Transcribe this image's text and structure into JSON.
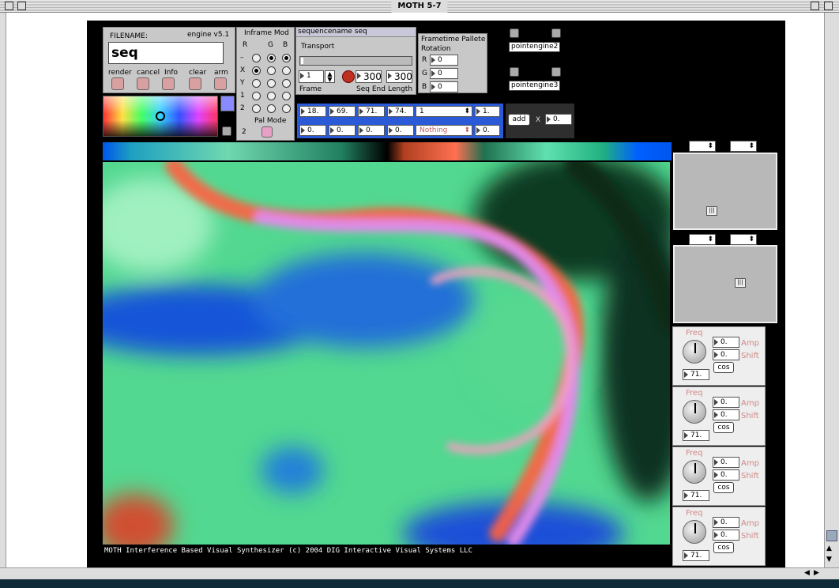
{
  "window": {
    "title": "MOTH 5-7"
  },
  "file_panel": {
    "filename_label": "FILENAME:",
    "version": "engine v5.1",
    "filename_value": "seq",
    "buttons": [
      "render",
      "cancel",
      "Info",
      "clear",
      "arm"
    ]
  },
  "inframe": {
    "title": "Inframe Mod",
    "cols": [
      "R",
      "G",
      "B"
    ],
    "rows": [
      "–",
      "X",
      "Y",
      "1",
      "2"
    ],
    "pal_label": "Pal Mode",
    "pal_value": "2"
  },
  "sequence": {
    "header": "sequencename seq",
    "transport": "Transport",
    "frame_value": "1",
    "frame_label": "Frame",
    "seq_end_value": "300",
    "seq_end_label": "Seq End",
    "length_value": "300",
    "length_label": "Length"
  },
  "palette": {
    "title": "Frametime Pallete",
    "subtitle": "Rotation",
    "r_label": "R",
    "r_value": "0",
    "g_label": "G",
    "g_value": "0",
    "b_label": "B",
    "b_value": "0"
  },
  "engines": {
    "engine2": "pointengine2",
    "engine3": "pointengine3"
  },
  "row1": {
    "v1": "18.",
    "v2": "69.",
    "v3": "71.",
    "v4": "74.",
    "menu": "1",
    "end": "1."
  },
  "row2": {
    "v1": "0.",
    "v2": "0.",
    "v3": "0.",
    "v4": "0.",
    "menu": "Nothing",
    "end": "0."
  },
  "add": {
    "label": "add",
    "x": "X",
    "value": "0."
  },
  "footer": "MOTH Interference Based Visual Synthesizer (c) 2004 DIG Interactive Visual Systems LLC",
  "lfos": [
    {
      "freq_label": "Freq",
      "amp_label": "Amp",
      "shift_label": "Shift",
      "amp": "0.",
      "shift": "0.",
      "freq": "71.",
      "wave": "cos"
    },
    {
      "freq_label": "Freq",
      "amp_label": "Amp",
      "shift_label": "Shift",
      "amp": "0.",
      "shift": "0.",
      "freq": "71.",
      "wave": "cos"
    },
    {
      "freq_label": "Freq",
      "amp_label": "Amp",
      "shift_label": "Shift",
      "amp": "0.",
      "shift": "0.",
      "freq": "71.",
      "wave": "cos"
    },
    {
      "freq_label": "Freq",
      "amp_label": "Amp",
      "shift_label": "Shift",
      "amp": "0.",
      "shift": "0.",
      "freq": "71.",
      "wave": "cos"
    }
  ]
}
